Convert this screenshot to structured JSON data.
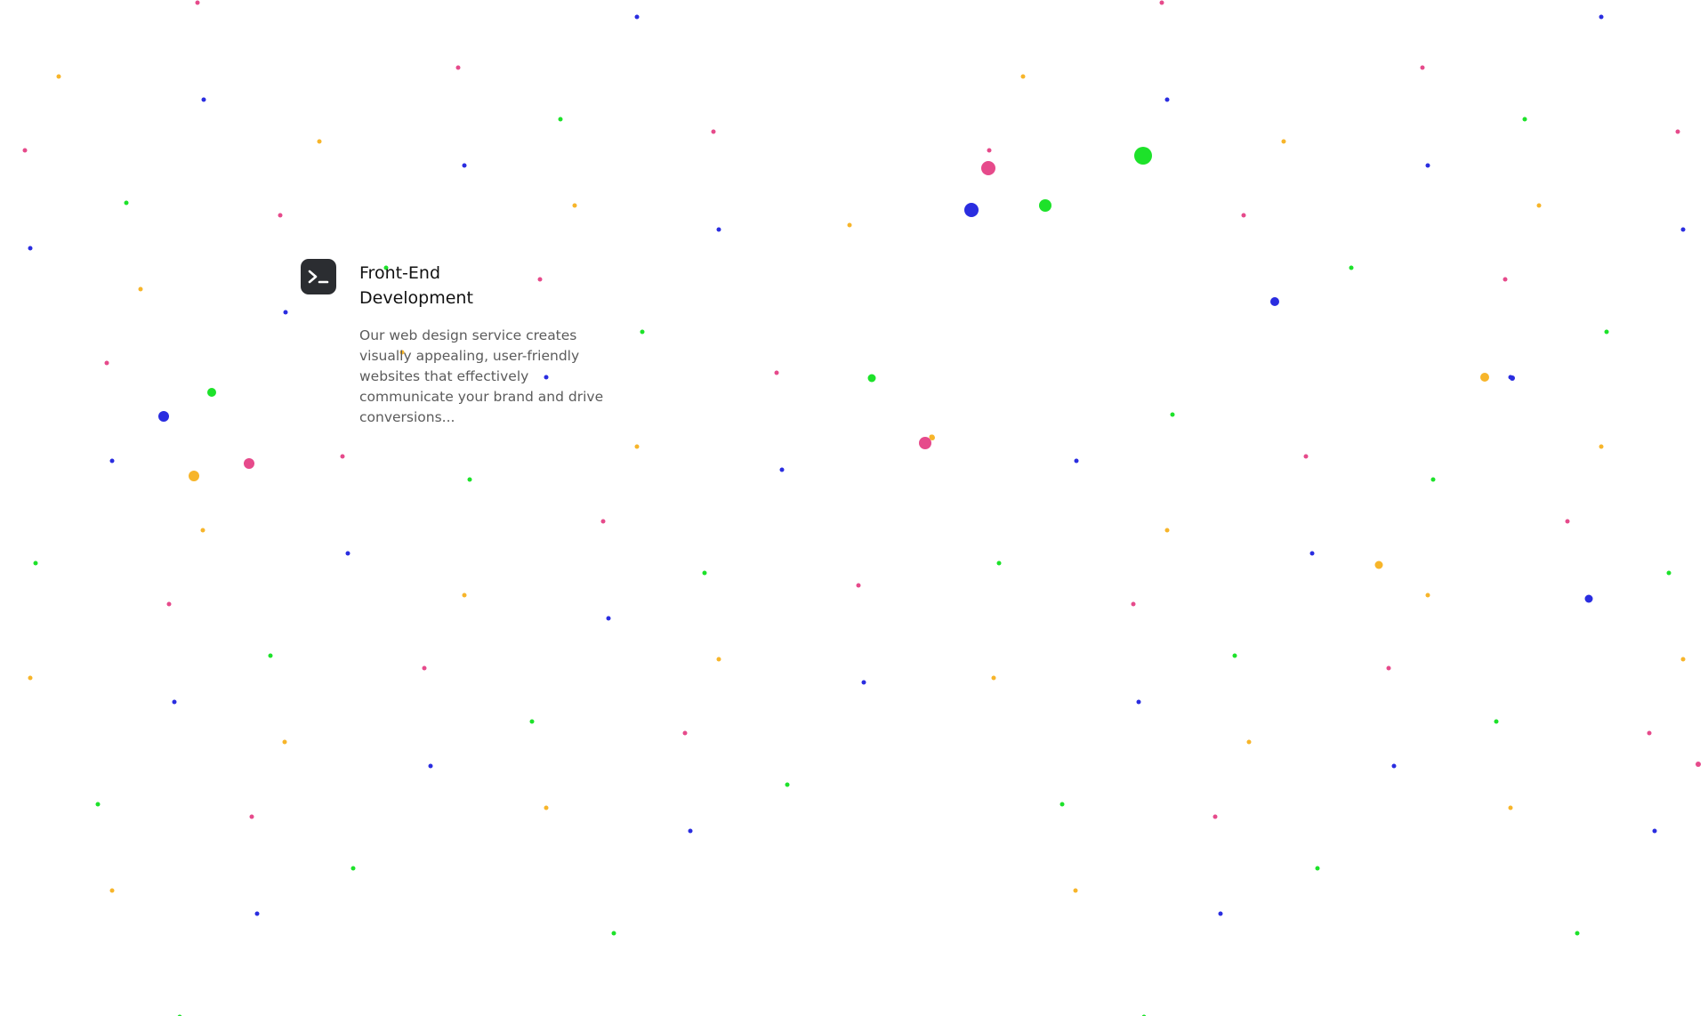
{
  "service": {
    "icon": "terminal-icon",
    "title": "Front-End Development",
    "description": "Our web design service creates visually appealing, user-friendly websites that effectively communicate your brand and drive conversions..."
  },
  "colors": {
    "background": "#ffffff",
    "icon_background": "#2b2d31",
    "pink": "#e64a8b",
    "blue": "#2a2de0",
    "green": "#1de22a",
    "yellow": "#f7b52a"
  }
}
